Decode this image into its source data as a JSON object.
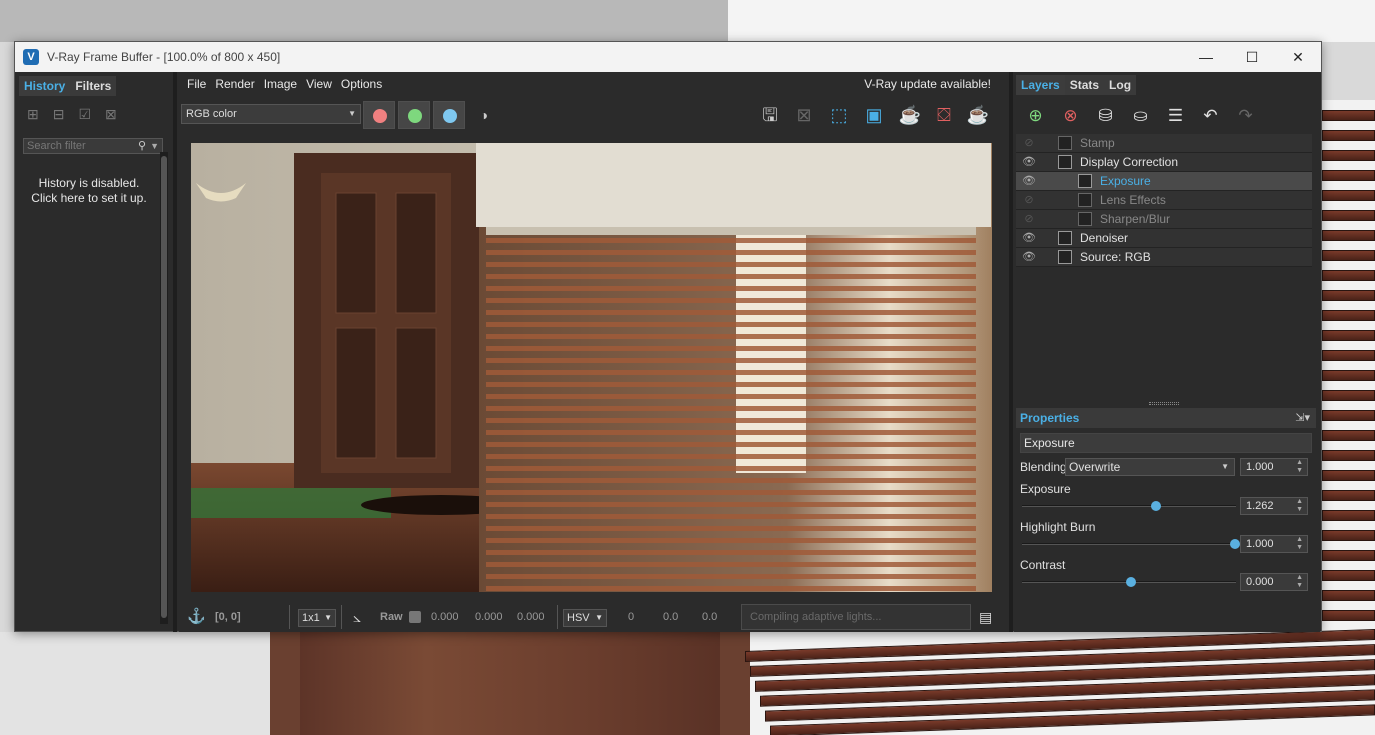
{
  "window": {
    "title": "V-Ray Frame Buffer - [100.0% of 800 x 450]",
    "logo": "V",
    "controls": {
      "minimize": "—",
      "maximize": "☐",
      "close": "✕"
    }
  },
  "left_panel": {
    "tabs": [
      "History",
      "Filters"
    ],
    "search_placeholder": "Search filter",
    "history_message_line1": "History is disabled.",
    "history_message_line2": "Click here to set it up."
  },
  "menu": {
    "items": [
      "File",
      "Render",
      "Image",
      "View",
      "Options"
    ],
    "update_notice": "V-Ray update available!"
  },
  "toolbar": {
    "channel": "RGB color",
    "colors": {
      "red": "#f08080",
      "green": "#7ed87e",
      "blue": "#7fc8f0"
    }
  },
  "statusbar": {
    "coords": "[0, 0]",
    "sampling": "1x1",
    "raw_label": "Raw",
    "raw_values": [
      "0.000",
      "0.000",
      "0.000"
    ],
    "color_mode": "HSV",
    "hsv_values": [
      "0",
      "0.0",
      "0.0"
    ],
    "progress_text": "Compiling adaptive lights..."
  },
  "right_panel": {
    "tabs": [
      "Layers",
      "Stats",
      "Log"
    ],
    "layers": [
      {
        "name": "Stamp",
        "visible": false,
        "indent": 1,
        "selected": false
      },
      {
        "name": "Display Correction",
        "visible": true,
        "indent": 1,
        "selected": false
      },
      {
        "name": "Exposure",
        "visible": true,
        "indent": 2,
        "selected": true
      },
      {
        "name": "Lens Effects",
        "visible": false,
        "indent": 2,
        "selected": false
      },
      {
        "name": "Sharpen/Blur",
        "visible": false,
        "indent": 2,
        "selected": false
      },
      {
        "name": "Denoiser",
        "visible": true,
        "indent": 1,
        "selected": false
      },
      {
        "name": "Source: RGB",
        "visible": true,
        "indent": 1,
        "selected": false
      }
    ],
    "properties": {
      "header": "Properties",
      "layer_name": "Exposure",
      "blending_label": "Blending",
      "blending_mode": "Overwrite",
      "blending_value": "1.000",
      "sliders": [
        {
          "label": "Exposure",
          "value": "1.262",
          "fraction": 0.62
        },
        {
          "label": "Highlight Burn",
          "value": "1.000",
          "fraction": 1.0
        },
        {
          "label": "Contrast",
          "value": "0.000",
          "fraction": 0.5
        }
      ]
    }
  }
}
